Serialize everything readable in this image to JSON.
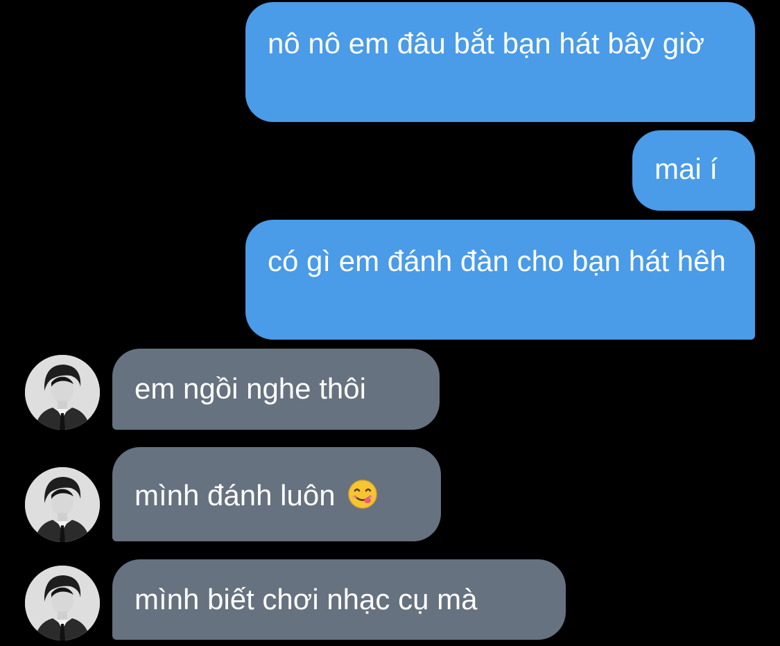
{
  "colors": {
    "background": "#000000",
    "outgoing_bubble": "#4a9be8",
    "incoming_bubble": "#677280",
    "text": "#ffffff"
  },
  "messages": [
    {
      "direction": "outgoing",
      "text": "nô nô em đâu bắt bạn hát bây giờ"
    },
    {
      "direction": "outgoing",
      "text": "mai í"
    },
    {
      "direction": "outgoing",
      "text": "có gì em đánh đàn cho bạn hát hêh"
    },
    {
      "direction": "incoming",
      "text": "em ngồi nghe thôi",
      "avatar": "avatar-photo"
    },
    {
      "direction": "incoming",
      "text": "mình đánh luôn",
      "emoji": "face-savoring-food-icon",
      "avatar": "avatar-photo"
    },
    {
      "direction": "incoming",
      "text": "mình biết chơi nhạc cụ mà",
      "avatar": "avatar-photo"
    }
  ]
}
